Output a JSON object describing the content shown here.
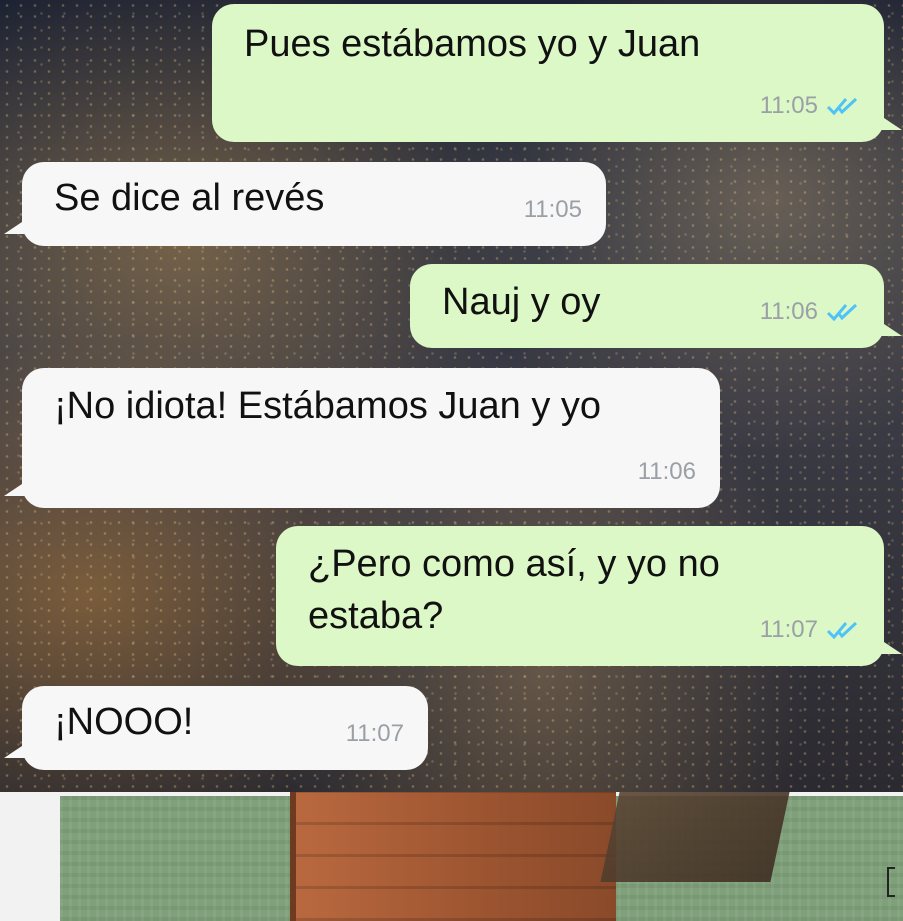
{
  "messages": [
    {
      "direction": "out",
      "text": "Pues estábamos yo y Juan",
      "time": "11:05",
      "status_icon": "double-check-icon"
    },
    {
      "direction": "in",
      "text": "Se dice al revés",
      "time": "11:05"
    },
    {
      "direction": "out",
      "text": "Nauj y oy",
      "time": "11:06",
      "status_icon": "double-check-icon"
    },
    {
      "direction": "in",
      "text": "¡No idiota! Estábamos Juan y yo",
      "time": "11:06"
    },
    {
      "direction": "out",
      "text": "¿Pero como así, y yo no estaba?",
      "time": "11:07",
      "status_icon": "double-check-icon"
    },
    {
      "direction": "in",
      "text": "¡NOOO!",
      "time": "11:07"
    }
  ],
  "colors": {
    "outgoing_bubble": "#dcf8c6",
    "incoming_bubble": "#f7f7f7",
    "timestamp": "#9aa0a6",
    "read_ticks": "#4fc3f7"
  }
}
